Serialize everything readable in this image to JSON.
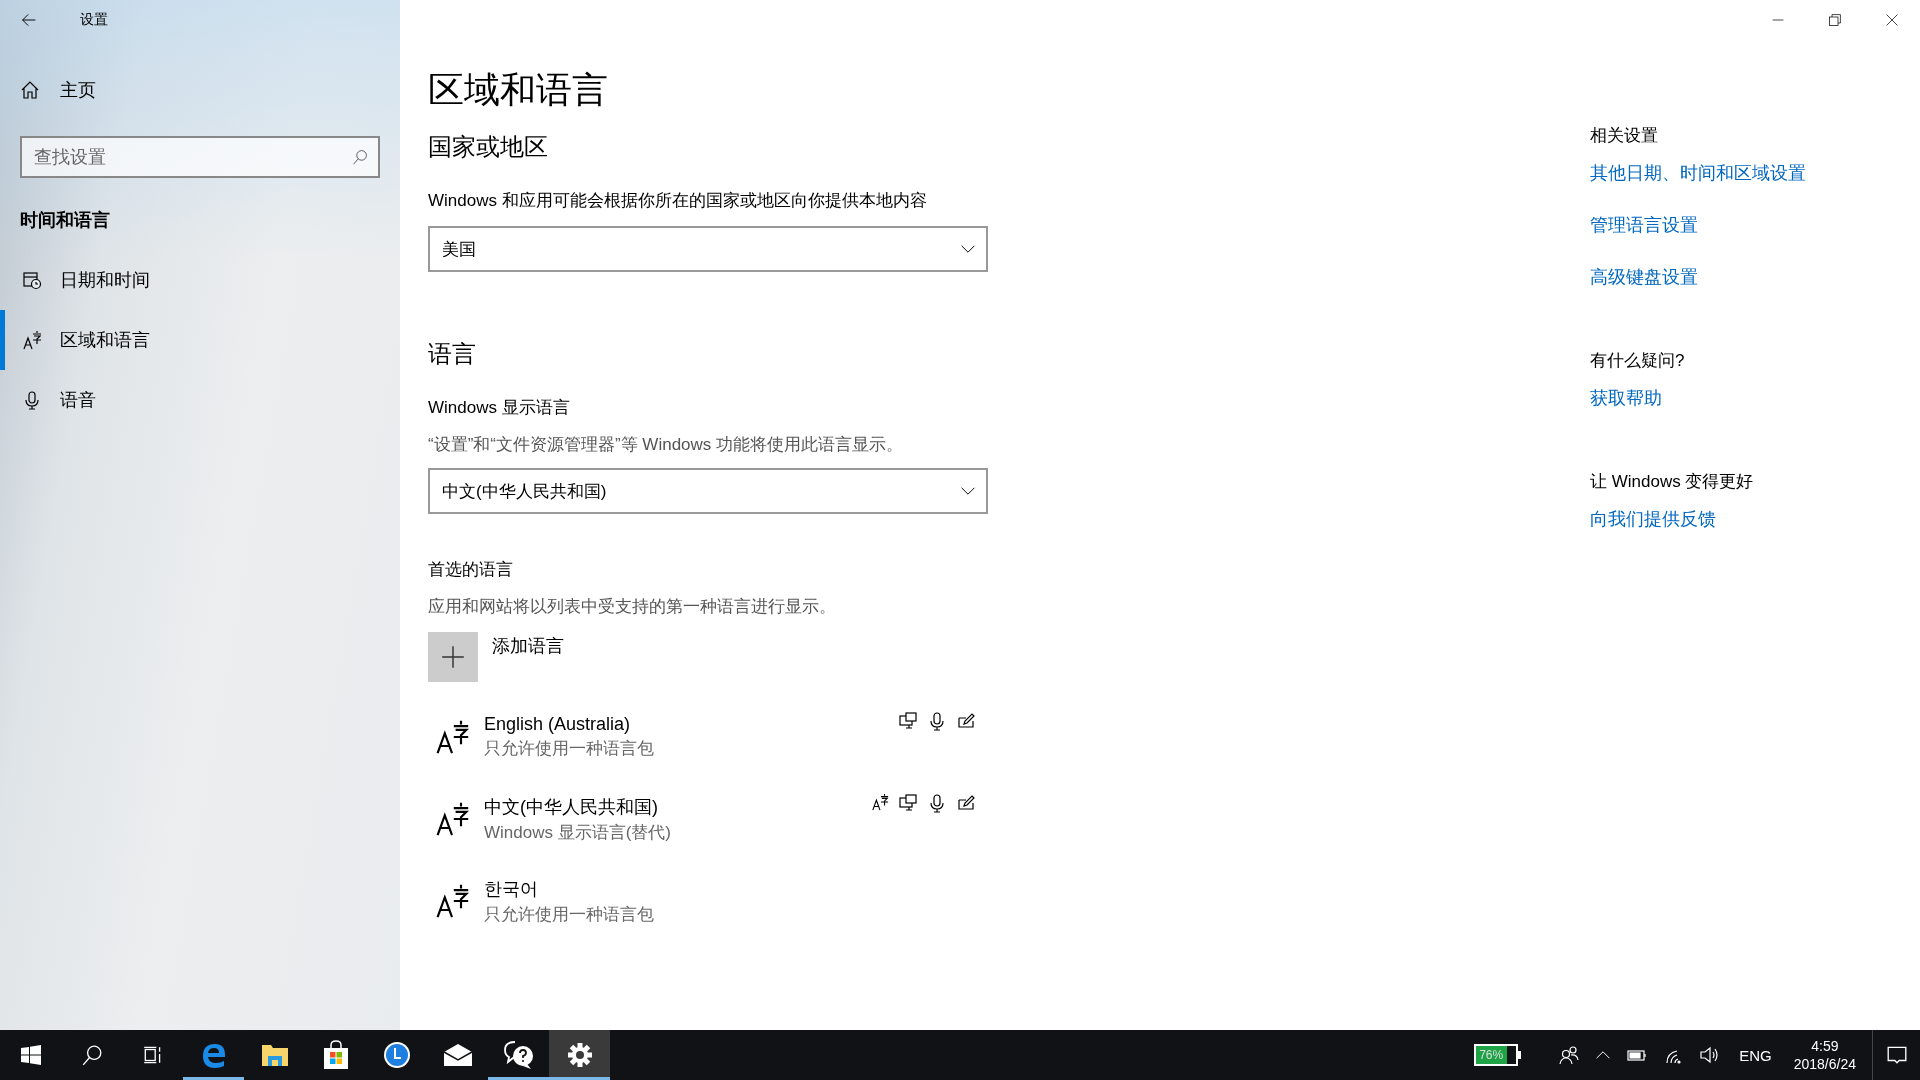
{
  "window": {
    "title": "设置"
  },
  "sidebar": {
    "home": "主页",
    "search": {
      "placeholder": "查找设置"
    },
    "section": "时间和语言",
    "items": [
      {
        "label": "日期和时间",
        "kind": "calendar",
        "selected": false
      },
      {
        "label": "区域和语言",
        "kind": "language",
        "selected": true
      },
      {
        "label": "语音",
        "kind": "microphone",
        "selected": false
      }
    ]
  },
  "page": {
    "title": "区域和语言",
    "region": {
      "heading": "国家或地区",
      "description": "Windows 和应用可能会根据你所在的国家或地区向你提供本地内容",
      "value": "美国"
    },
    "language": {
      "heading": "语言",
      "display_label": "Windows 显示语言",
      "display_description": "“设置”和“文件资源管理器”等 Windows 功能将使用此语言显示。",
      "display_value": "中文(中华人民共和国)",
      "preferred_heading": "首选的语言",
      "preferred_description": "应用和网站将以列表中受支持的第一种语言进行显示。",
      "add_label": "添加语言",
      "languages": [
        {
          "name": "English (Australia)",
          "status": "只允许使用一种语言包",
          "features": [
            {
              "kind": "display"
            },
            {
              "kind": "speech"
            },
            {
              "kind": "handwriting"
            }
          ]
        },
        {
          "name": "中文(中华人民共和国)",
          "status": "Windows 显示语言(替代)",
          "features": [
            {
              "kind": "language-pack"
            },
            {
              "kind": "display"
            },
            {
              "kind": "speech"
            },
            {
              "kind": "handwriting"
            }
          ]
        },
        {
          "name": "한국어",
          "status": "只允许使用一种语言包"
        }
      ]
    }
  },
  "related": [
    {
      "heading": "相关设置",
      "links": [
        "其他日期、时间和区域设置",
        "管理语言设置",
        "高级键盘设置"
      ]
    },
    {
      "heading": "有什么疑问?",
      "links": [
        "获取帮助"
      ]
    },
    {
      "heading": "让 Windows 变得更好",
      "links": [
        "向我们提供反馈"
      ]
    }
  ],
  "taskbar": {
    "apps": [
      {
        "kind": "start",
        "running": false,
        "active": false
      },
      {
        "kind": "search",
        "running": false,
        "active": false
      },
      {
        "kind": "task-view",
        "running": false,
        "active": false
      },
      {
        "kind": "browser",
        "running": true,
        "active": false
      },
      {
        "kind": "folder",
        "running": false,
        "active": false
      },
      {
        "kind": "store",
        "running": false,
        "active": false
      },
      {
        "kind": "clock",
        "running": false,
        "active": false
      },
      {
        "kind": "mail",
        "running": false,
        "active": false
      },
      {
        "kind": "feedback",
        "running": true,
        "active": false
      },
      {
        "kind": "settings",
        "running": true,
        "active": true
      }
    ],
    "battery": {
      "text": "76%",
      "level": 0.76
    },
    "input_language": "ENG",
    "time": "4:59",
    "date": "2018/6/24"
  }
}
